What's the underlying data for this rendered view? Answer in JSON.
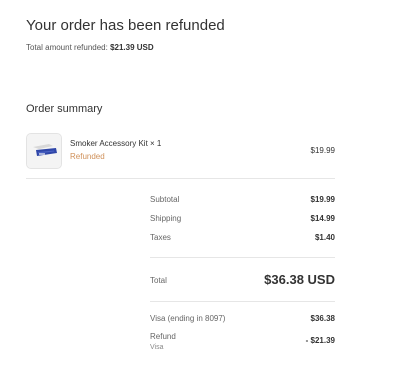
{
  "header": {
    "title": "Your order has been refunded",
    "refund_label": "Total amount refunded:",
    "refund_amount": "$21.39 USD"
  },
  "summary": {
    "heading": "Order summary",
    "item": {
      "name": "Smoker Accessory Kit × 1",
      "status": "Refunded",
      "price": "$19.99",
      "thumbnail_icon": "product-thumbnail-icon"
    },
    "subtotal": {
      "label": "Subtotal",
      "value": "$19.99"
    },
    "shipping": {
      "label": "Shipping",
      "value": "$14.99"
    },
    "taxes": {
      "label": "Taxes",
      "value": "$1.40"
    },
    "total": {
      "label": "Total",
      "value": "$36.38 USD"
    },
    "payment": {
      "label": "Visa (ending in 8097)",
      "value": "$36.38"
    },
    "refund": {
      "label": "Refund",
      "sublabel": "Visa",
      "value": "- $21.39"
    }
  },
  "colors": {
    "refunded_status": "#d0915a",
    "text": "#333333",
    "muted": "#666666",
    "divider": "#e6e6e6"
  }
}
